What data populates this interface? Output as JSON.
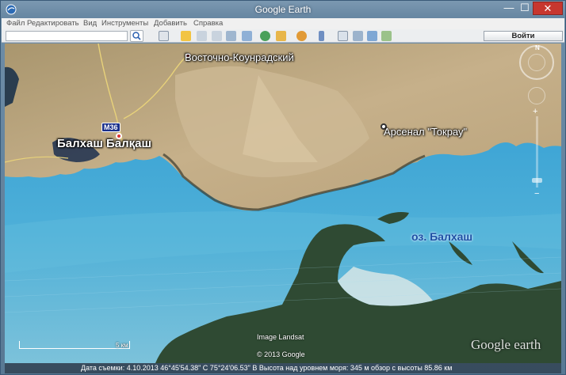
{
  "window": {
    "title": "Google Earth",
    "min_glyph": "—",
    "max_glyph": "☐",
    "close_glyph": "✕"
  },
  "menu": {
    "items": [
      "Файл",
      "Редактировать",
      "Вид",
      "Инструменты",
      "Добавить",
      "Справка"
    ]
  },
  "toolbar": {
    "search_value": "",
    "signin_label": "Войти",
    "icons": [
      "search-icon",
      "sidebar-toggle-icon",
      "placemark-icon",
      "polygon-icon",
      "path-icon",
      "image-overlay-icon",
      "record-tour-icon",
      "historical-imagery-icon",
      "sunlight-icon",
      "planets-icon",
      "ruler-icon",
      "email-icon",
      "print-icon",
      "view-in-maps-icon"
    ]
  },
  "map": {
    "places": {
      "vostochno": "Восточно-Коунрадский",
      "arsenal": "Арсенал \"Токрау\"",
      "balkhash": "Балхаш Балқаш",
      "lake": "оз. Балхаш"
    },
    "road_shield": "M36",
    "image_credit": "Image Landsat",
    "copyright": "© 2013 Google",
    "logo": "Google earth",
    "scale_label": "5 км",
    "compass_n": "N",
    "colors": {
      "water": "#3c9ecf",
      "land": "#c3ad84",
      "reed": "#2f4a33"
    }
  },
  "status": {
    "text": "Дата съемки: 4.10.2013    46°45'54.38\" С    75°24'06.53\" В  Высота над уровнем моря:   345 м    обзор с высоты  85.86 км"
  }
}
